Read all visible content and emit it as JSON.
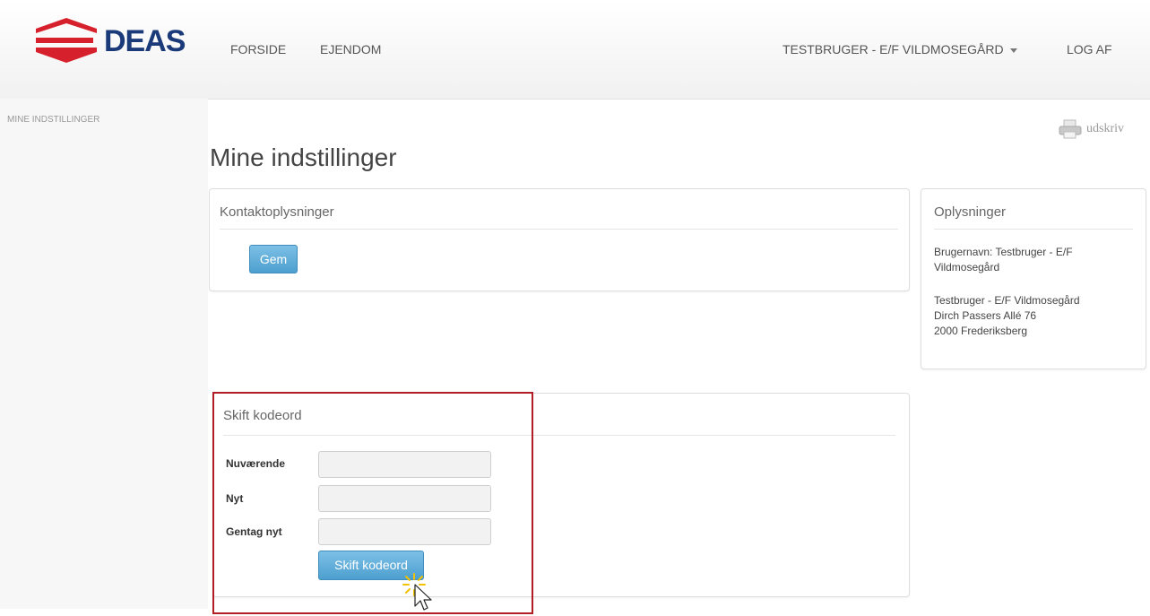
{
  "header": {
    "logo_text": "DEAS",
    "nav": {
      "forside": "FORSIDE",
      "ejendom": "EJENDOM",
      "user_menu": "TESTBRUGER - E/F VILDMOSEGÅRD",
      "logout": "LOG AF"
    },
    "brand_colors": {
      "red": "#d6202b",
      "navy": "#1b3a79"
    }
  },
  "breadcrumb": "MINE INDSTILLINGER",
  "print_label": "udskriv",
  "page_title": "Mine indstillinger",
  "contact_panel": {
    "title": "Kontaktoplysninger",
    "save_button": "Gem"
  },
  "info_panel": {
    "title": "Oplysninger",
    "username_line": "Brugernavn: Testbruger - E/F Vildmosegård",
    "address_line1": "Testbruger - E/F Vildmosegård",
    "address_line2": "Dirch Passers Allé 76",
    "address_line3": "2000 Frederiksberg"
  },
  "password_panel": {
    "title": "Skift kodeord",
    "current_label": "Nuværende",
    "new_label": "Nyt",
    "repeat_label": "Gentag nyt",
    "current_value": "",
    "new_value": "",
    "repeat_value": "",
    "submit_button": "Skift kodeord"
  },
  "colors": {
    "button": "#5aa9d8",
    "highlight": "#b01e23"
  },
  "icons": {
    "print": "printer-icon",
    "logo_mark": "deas-logo-icon",
    "cursor": "mouse-pointer-icon"
  }
}
